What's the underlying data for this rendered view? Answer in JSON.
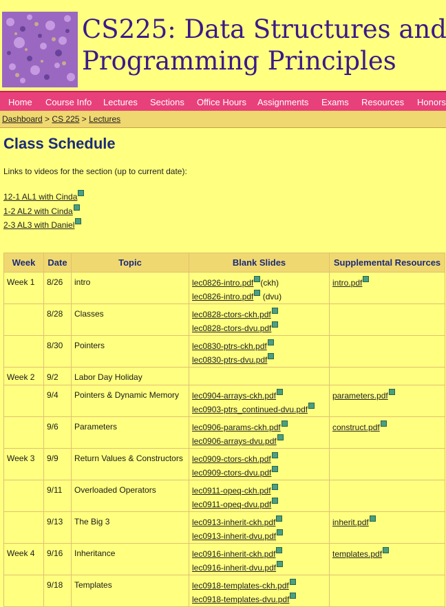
{
  "header": {
    "title_line1": "CS225: Data Structures and",
    "title_line2": "Programming Principles"
  },
  "nav": {
    "items": [
      {
        "label": "Home"
      },
      {
        "label": "Course Info"
      },
      {
        "label": "Lectures"
      },
      {
        "label": "Sections"
      },
      {
        "label": "Office Hours"
      },
      {
        "label": "Assignments"
      },
      {
        "label": "Exams"
      },
      {
        "label": "Resources"
      },
      {
        "label": "Honors"
      }
    ]
  },
  "breadcrumb": {
    "items": [
      "Dashboard",
      "CS 225",
      "Lectures"
    ],
    "sep": " > "
  },
  "page": {
    "title": "Class Schedule",
    "intro": "Links to videos for the section (up to current date):",
    "video_links": [
      "12-1 AL1 with Cinda",
      "1-2 AL2 with Cinda",
      "2-3 AL3 with Daniel"
    ]
  },
  "table": {
    "headers": [
      "Week",
      "Date",
      "Topic",
      "Blank Slides",
      "Supplemental Resources"
    ],
    "rows": [
      {
        "week": "Week 1",
        "date": "8/26",
        "topic": "intro",
        "slides": [
          {
            "file": "lec0826-intro.pdf",
            "note": "(ckh)"
          },
          {
            "file": "lec0826-intro.pdf",
            "note": " (dvu)"
          }
        ],
        "resource": "intro.pdf"
      },
      {
        "week": "",
        "date": "8/28",
        "topic": "Classes",
        "slides": [
          {
            "file": "lec0828-ctors-ckh.pdf",
            "note": ""
          },
          {
            "file": "lec0828-ctors-dvu.pdf",
            "note": ""
          }
        ],
        "resource": ""
      },
      {
        "week": "",
        "date": "8/30",
        "topic": "Pointers",
        "slides": [
          {
            "file": "lec0830-ptrs-ckh.pdf",
            "note": ""
          },
          {
            "file": "lec0830-ptrs-dvu.pdf",
            "note": ""
          }
        ],
        "resource": ""
      },
      {
        "week": "Week 2",
        "date": "9/2",
        "topic": "Labor Day Holiday",
        "slides": [],
        "resource": ""
      },
      {
        "week": "",
        "date": "9/4",
        "topic": "Pointers & Dynamic Memory",
        "slides": [
          {
            "file": "lec0904-arrays-ckh.pdf",
            "note": ""
          },
          {
            "file": "lec0903-ptrs_continued-dvu.pdf",
            "note": ""
          }
        ],
        "resource": "parameters.pdf"
      },
      {
        "week": "",
        "date": "9/6",
        "topic": "Parameters",
        "slides": [
          {
            "file": "lec0906-params-ckh.pdf",
            "note": ""
          },
          {
            "file": "lec0906-arrays-dvu.pdf",
            "note": ""
          }
        ],
        "resource": "construct.pdf"
      },
      {
        "week": "Week 3",
        "date": "9/9",
        "topic": "Return Values & Constructors",
        "slides": [
          {
            "file": "lec0909-ctors-ckh.pdf",
            "note": ""
          },
          {
            "file": "lec0909-ctors-dvu.pdf",
            "note": ""
          }
        ],
        "resource": ""
      },
      {
        "week": "",
        "date": "9/11",
        "topic": "Overloaded Operators",
        "slides": [
          {
            "file": "lec0911-opeq-ckh.pdf",
            "note": ""
          },
          {
            "file": "lec0911-opeq-dvu.pdf",
            "note": ""
          }
        ],
        "resource": ""
      },
      {
        "week": "",
        "date": "9/13",
        "topic": "The Big 3",
        "slides": [
          {
            "file": "lec0913-inherit-ckh.pdf",
            "note": ""
          },
          {
            "file": "lec0913-inherit-dvu.pdf",
            "note": ""
          }
        ],
        "resource": "inherit.pdf"
      },
      {
        "week": "Week 4",
        "date": "9/16",
        "topic": "Inheritance",
        "slides": [
          {
            "file": "lec0916-inherit-ckh.pdf",
            "note": ""
          },
          {
            "file": "lec0916-inherit-dvu.pdf",
            "note": ""
          }
        ],
        "resource": "templates.pdf"
      },
      {
        "week": "",
        "date": "9/18",
        "topic": "Templates",
        "slides": [
          {
            "file": "lec0918-templates-ckh.pdf",
            "note": ""
          },
          {
            "file": "lec0918-templates-dvu.pdf",
            "note": ""
          }
        ],
        "resource": ""
      }
    ]
  },
  "colors": {
    "background": "#ffff80",
    "nav_bg": "#e8407a",
    "crumb_bg": "#f0d870",
    "title": "#1a2a7a",
    "site_title": "#3a1a8a"
  }
}
